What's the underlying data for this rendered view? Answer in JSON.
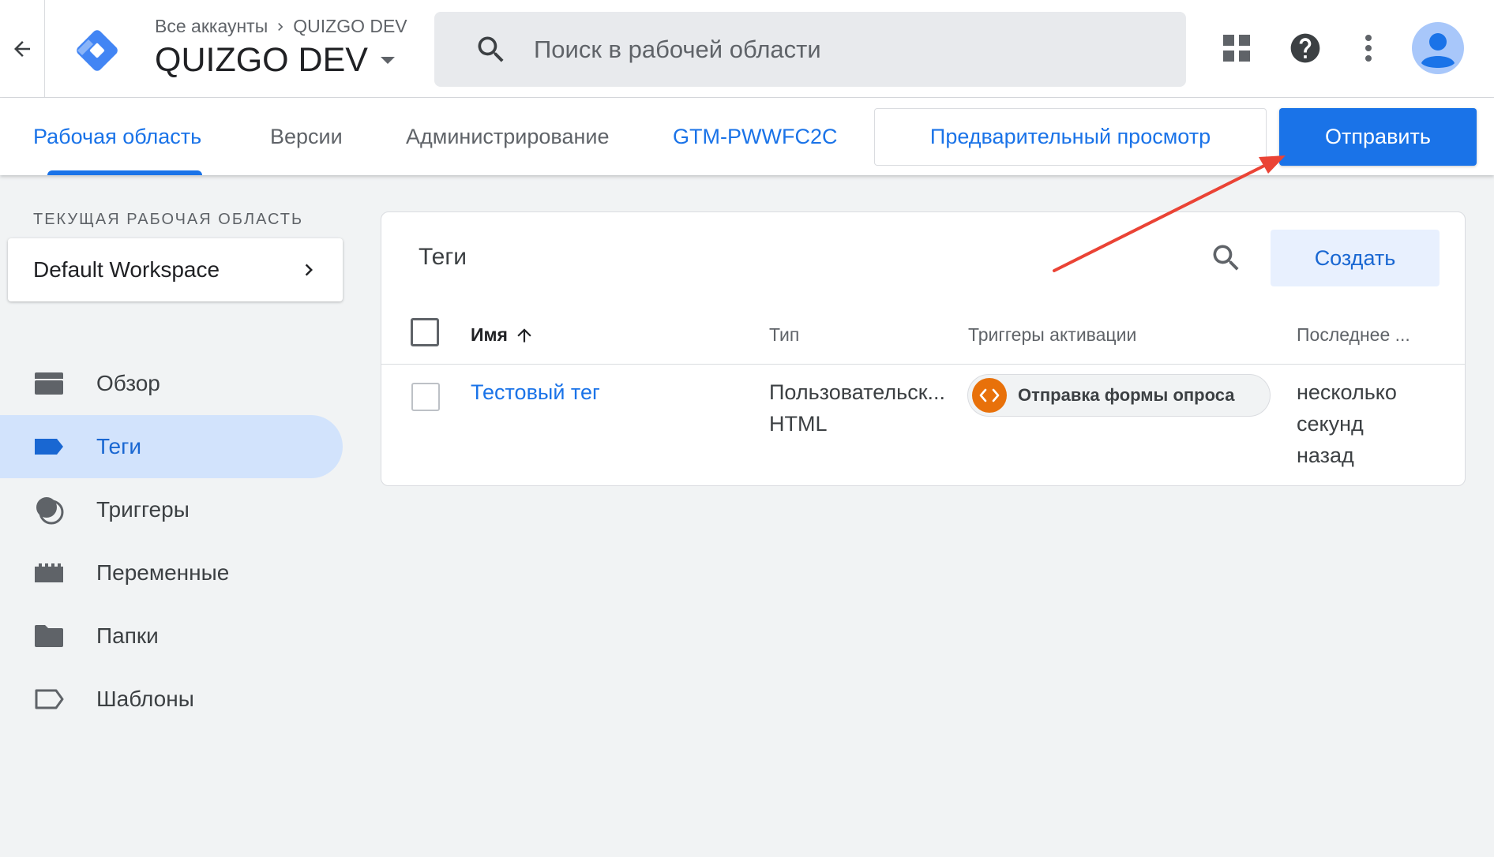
{
  "header": {
    "breadcrumb_root": "Все аккаунты",
    "breadcrumb_current": "QUIZGO DEV",
    "container_name": "QUIZGO DEV",
    "search_placeholder": "Поиск в рабочей области"
  },
  "nav": {
    "tabs": [
      {
        "label": "Рабочая область",
        "active": true
      },
      {
        "label": "Версии",
        "active": false
      },
      {
        "label": "Администрирование",
        "active": false
      }
    ],
    "container_id": "GTM-PWWFC2C",
    "preview_label": "Предварительный просмотр",
    "submit_label": "Отправить"
  },
  "sidebar": {
    "workspace_label": "ТЕКУЩАЯ РАБОЧАЯ ОБЛАСТЬ",
    "workspace_name": "Default Workspace",
    "items": [
      {
        "label": "Обзор",
        "icon": "overview-icon",
        "active": false
      },
      {
        "label": "Теги",
        "icon": "tag-icon",
        "active": true
      },
      {
        "label": "Триггеры",
        "icon": "trigger-icon",
        "active": false
      },
      {
        "label": "Переменные",
        "icon": "variables-icon",
        "active": false
      },
      {
        "label": "Папки",
        "icon": "folder-icon",
        "active": false
      },
      {
        "label": "Шаблоны",
        "icon": "template-icon",
        "active": false
      }
    ]
  },
  "tags_table": {
    "title": "Теги",
    "create_label": "Создать",
    "columns": {
      "name": "Имя",
      "type": "Тип",
      "triggers": "Триггеры активации",
      "last_edited": "Последнее ..."
    },
    "rows": [
      {
        "name": "Тестовый тег",
        "type_line1": "Пользовательск...",
        "type_line2": "HTML",
        "trigger": "Отправка формы опроса",
        "edited_line1": "несколько",
        "edited_line2": "секунд",
        "edited_line3": "назад"
      }
    ]
  },
  "colors": {
    "accent": "#1a73e8",
    "active_nav_bg": "#d2e3fc",
    "trigger_chip_icon": "#e8710a",
    "annotation_arrow": "#ea4335"
  }
}
